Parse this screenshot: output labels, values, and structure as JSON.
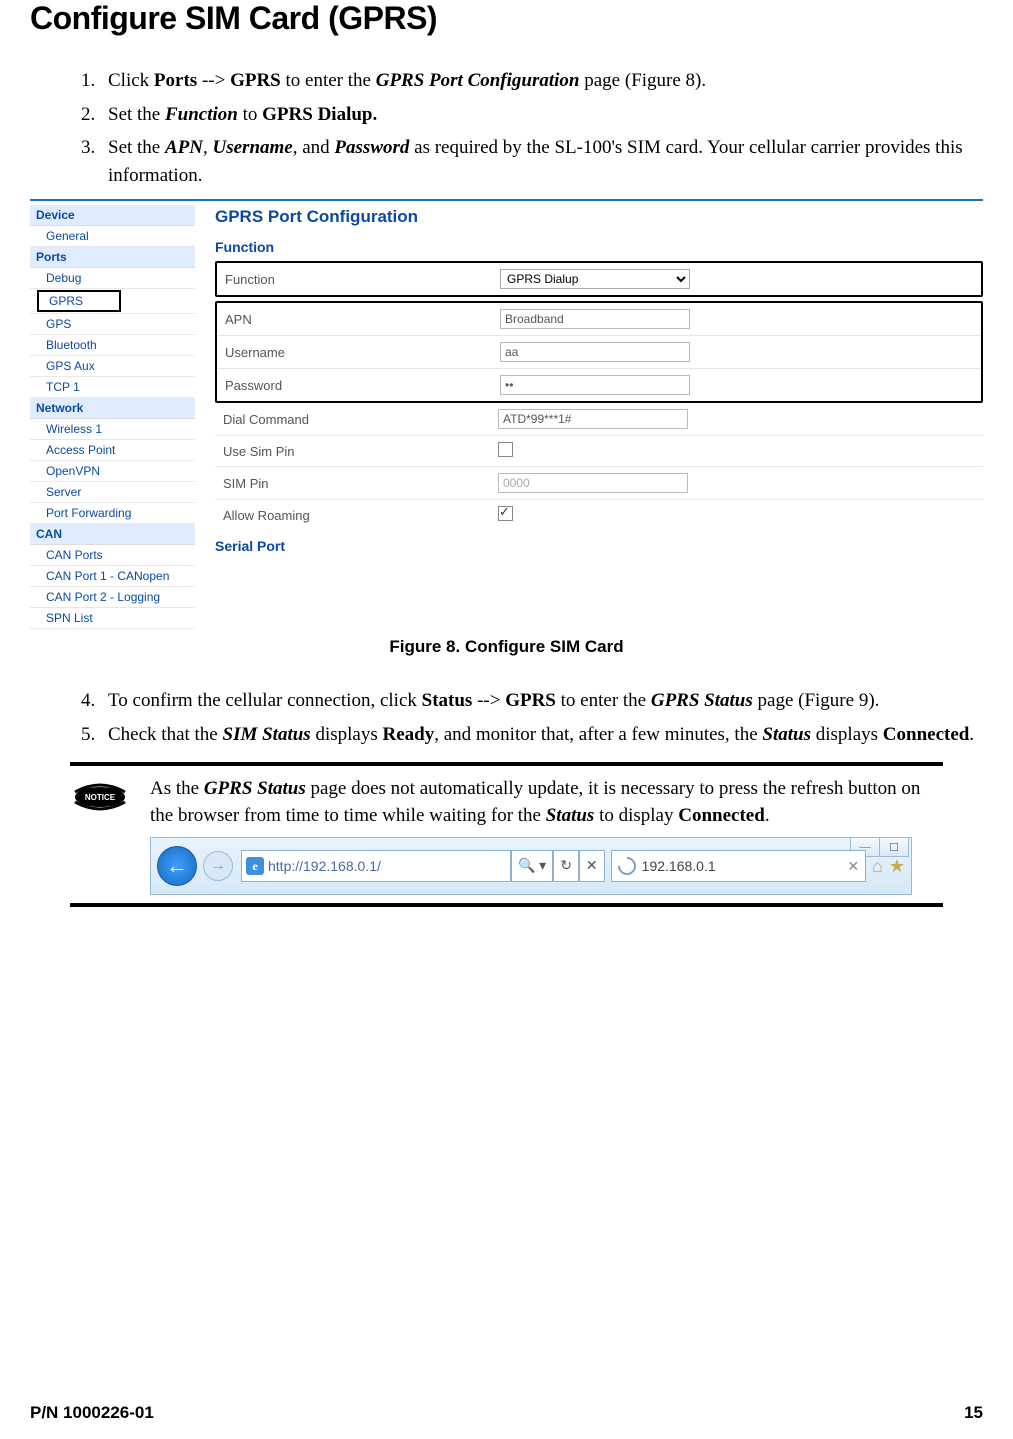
{
  "title": "Configure SIM Card (GPRS)",
  "steps_a": [
    {
      "prefix": "Click ",
      "b1": "Ports",
      "mid": " --> ",
      "b2": "GPRS",
      "mid2": " to enter the ",
      "bi": "GPRS Port Configuration",
      "suffix": " page (Figure 8)."
    },
    {
      "prefix": "Set the ",
      "bi": "Function",
      "mid": " to ",
      "b1": "GPRS Dialup.",
      "suffix": ""
    },
    {
      "prefix": "Set the ",
      "bi": "APN",
      "mid": ", ",
      "bi2": "Username",
      "mid2": ", and ",
      "bi3": "Password",
      "suffix": " as required by the SL-100's SIM card. Your cellular carrier provides this information."
    }
  ],
  "sidebar": {
    "sections": [
      {
        "header": "Device",
        "items": [
          "General"
        ]
      },
      {
        "header": "Ports",
        "items": [
          "Debug",
          "GPRS",
          "GPS",
          "Bluetooth",
          "GPS Aux",
          "TCP 1"
        ]
      },
      {
        "header": "Network",
        "items": [
          "Wireless 1",
          "Access Point",
          "OpenVPN",
          "Server",
          "Port Forwarding"
        ]
      },
      {
        "header": "CAN",
        "items": [
          "CAN Ports",
          "CAN Port 1 - CANopen",
          "CAN Port 2 - Logging",
          "SPN List"
        ]
      }
    ],
    "selected": "GPRS"
  },
  "panel": {
    "title": "GPRS Port Configuration",
    "sub1": "Function",
    "rows_box1": [
      {
        "label": "Function",
        "value": "GPRS Dialup",
        "kind": "select"
      }
    ],
    "rows_box2": [
      {
        "label": "APN",
        "value": "Broadband",
        "kind": "text"
      },
      {
        "label": "Username",
        "value": "aa",
        "kind": "text"
      },
      {
        "label": "Password",
        "value": "••",
        "kind": "text"
      }
    ],
    "rows_plain": [
      {
        "label": "Dial Command",
        "value": "ATD*99***1#",
        "kind": "text"
      },
      {
        "label": "Use Sim Pin",
        "value": "",
        "kind": "check",
        "checked": false
      },
      {
        "label": "SIM Pin",
        "value": "0000",
        "kind": "text"
      },
      {
        "label": "Allow Roaming",
        "value": "",
        "kind": "check",
        "checked": true
      }
    ],
    "sub2": "Serial Port"
  },
  "caption1": "Figure 8. Configure SIM Card",
  "steps_b": [
    {
      "n": "4.",
      "prefix": "To confirm the cellular connection, click ",
      "b1": "Status",
      "mid": " --> ",
      "b2": "GPRS",
      "mid2": " to enter the ",
      "bi": "GPRS Status",
      "suffix": " page (Figure 9)."
    },
    {
      "n": "5.",
      "prefix": "Check that the ",
      "bi": "SIM Status",
      "mid": " displays ",
      "b1": "Ready",
      "mid2": ", and monitor that, after a few minutes, the ",
      "bi2": "Status",
      "mid3": " displays ",
      "b2": "Connected",
      "suffix": "."
    }
  ],
  "notice": {
    "label": "NOTICE",
    "text_parts": {
      "p1": "As the ",
      "bi1": "GPRS Status",
      "p2": " page does not automatically update, it is necessary to press the refresh button on the browser from time to time while waiting for the ",
      "bi2": "Status",
      "p3": " to display ",
      "b1": "Connected",
      "p4": "."
    }
  },
  "browser": {
    "url": "http://192.168.0.1/",
    "tab": "192.168.0.1"
  },
  "footer": {
    "left": "P/N 1000226-01",
    "right": "15"
  }
}
